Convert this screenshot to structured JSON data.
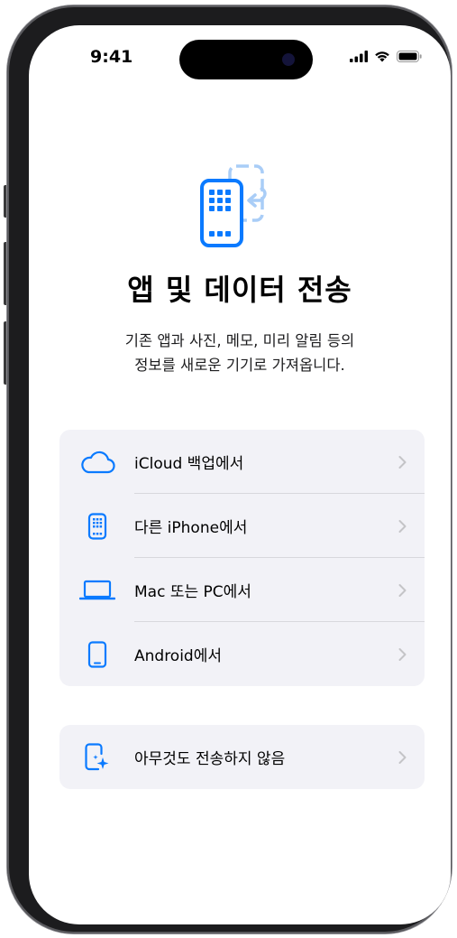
{
  "status_bar": {
    "time": "9:41"
  },
  "header": {
    "title": "앱 및 데이터 전송",
    "description_line1": "기존 앱과 사진, 메모, 미리 알림 등의",
    "description_line2": "정보를 새로운 기기로 가져옵니다."
  },
  "options": [
    {
      "label": "iCloud 백업에서",
      "icon": "cloud-icon"
    },
    {
      "label": "다른 iPhone에서",
      "icon": "iphone-icon"
    },
    {
      "label": "Mac 또는 PC에서",
      "icon": "laptop-icon"
    },
    {
      "label": "Android에서",
      "icon": "android-phone-icon"
    }
  ],
  "secondary_option": {
    "label": "아무것도 전송하지 않음",
    "icon": "phone-sparkle-icon"
  },
  "colors": {
    "accent": "#0a7aff",
    "accent_light": "#a9cdf7",
    "group_bg": "#f2f2f7",
    "chevron": "#c4c4c7"
  }
}
